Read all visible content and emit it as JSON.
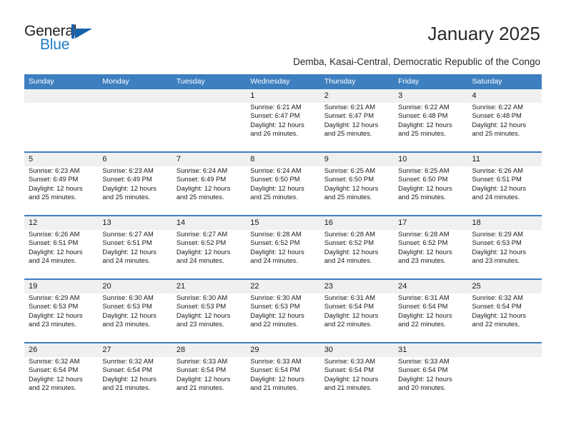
{
  "brand": {
    "name_part1": "General",
    "name_part2": "Blue",
    "accent_color": "#1d7cc4",
    "logo_mark_color": "#1763ab"
  },
  "header": {
    "title": "January 2025",
    "subtitle": "Demba, Kasai-Central, Democratic Republic of the Congo"
  },
  "theme": {
    "header_blue": "#3d7fbf",
    "daynum_band": "#f0f0f0",
    "week_separator": "#3d7fbf"
  },
  "weekdays": [
    "Sunday",
    "Monday",
    "Tuesday",
    "Wednesday",
    "Thursday",
    "Friday",
    "Saturday"
  ],
  "weeks": [
    [
      {
        "day": "",
        "l1": "",
        "l2": "",
        "l3": "",
        "l4": ""
      },
      {
        "day": "",
        "l1": "",
        "l2": "",
        "l3": "",
        "l4": ""
      },
      {
        "day": "",
        "l1": "",
        "l2": "",
        "l3": "",
        "l4": ""
      },
      {
        "day": "1",
        "l1": "Sunrise: 6:21 AM",
        "l2": "Sunset: 6:47 PM",
        "l3": "Daylight: 12 hours",
        "l4": "and 26 minutes."
      },
      {
        "day": "2",
        "l1": "Sunrise: 6:21 AM",
        "l2": "Sunset: 6:47 PM",
        "l3": "Daylight: 12 hours",
        "l4": "and 25 minutes."
      },
      {
        "day": "3",
        "l1": "Sunrise: 6:22 AM",
        "l2": "Sunset: 6:48 PM",
        "l3": "Daylight: 12 hours",
        "l4": "and 25 minutes."
      },
      {
        "day": "4",
        "l1": "Sunrise: 6:22 AM",
        "l2": "Sunset: 6:48 PM",
        "l3": "Daylight: 12 hours",
        "l4": "and 25 minutes."
      }
    ],
    [
      {
        "day": "5",
        "l1": "Sunrise: 6:23 AM",
        "l2": "Sunset: 6:49 PM",
        "l3": "Daylight: 12 hours",
        "l4": "and 25 minutes."
      },
      {
        "day": "6",
        "l1": "Sunrise: 6:23 AM",
        "l2": "Sunset: 6:49 PM",
        "l3": "Daylight: 12 hours",
        "l4": "and 25 minutes."
      },
      {
        "day": "7",
        "l1": "Sunrise: 6:24 AM",
        "l2": "Sunset: 6:49 PM",
        "l3": "Daylight: 12 hours",
        "l4": "and 25 minutes."
      },
      {
        "day": "8",
        "l1": "Sunrise: 6:24 AM",
        "l2": "Sunset: 6:50 PM",
        "l3": "Daylight: 12 hours",
        "l4": "and 25 minutes."
      },
      {
        "day": "9",
        "l1": "Sunrise: 6:25 AM",
        "l2": "Sunset: 6:50 PM",
        "l3": "Daylight: 12 hours",
        "l4": "and 25 minutes."
      },
      {
        "day": "10",
        "l1": "Sunrise: 6:25 AM",
        "l2": "Sunset: 6:50 PM",
        "l3": "Daylight: 12 hours",
        "l4": "and 25 minutes."
      },
      {
        "day": "11",
        "l1": "Sunrise: 6:26 AM",
        "l2": "Sunset: 6:51 PM",
        "l3": "Daylight: 12 hours",
        "l4": "and 24 minutes."
      }
    ],
    [
      {
        "day": "12",
        "l1": "Sunrise: 6:26 AM",
        "l2": "Sunset: 6:51 PM",
        "l3": "Daylight: 12 hours",
        "l4": "and 24 minutes."
      },
      {
        "day": "13",
        "l1": "Sunrise: 6:27 AM",
        "l2": "Sunset: 6:51 PM",
        "l3": "Daylight: 12 hours",
        "l4": "and 24 minutes."
      },
      {
        "day": "14",
        "l1": "Sunrise: 6:27 AM",
        "l2": "Sunset: 6:52 PM",
        "l3": "Daylight: 12 hours",
        "l4": "and 24 minutes."
      },
      {
        "day": "15",
        "l1": "Sunrise: 6:28 AM",
        "l2": "Sunset: 6:52 PM",
        "l3": "Daylight: 12 hours",
        "l4": "and 24 minutes."
      },
      {
        "day": "16",
        "l1": "Sunrise: 6:28 AM",
        "l2": "Sunset: 6:52 PM",
        "l3": "Daylight: 12 hours",
        "l4": "and 24 minutes."
      },
      {
        "day": "17",
        "l1": "Sunrise: 6:28 AM",
        "l2": "Sunset: 6:52 PM",
        "l3": "Daylight: 12 hours",
        "l4": "and 23 minutes."
      },
      {
        "day": "18",
        "l1": "Sunrise: 6:29 AM",
        "l2": "Sunset: 6:53 PM",
        "l3": "Daylight: 12 hours",
        "l4": "and 23 minutes."
      }
    ],
    [
      {
        "day": "19",
        "l1": "Sunrise: 6:29 AM",
        "l2": "Sunset: 6:53 PM",
        "l3": "Daylight: 12 hours",
        "l4": "and 23 minutes."
      },
      {
        "day": "20",
        "l1": "Sunrise: 6:30 AM",
        "l2": "Sunset: 6:53 PM",
        "l3": "Daylight: 12 hours",
        "l4": "and 23 minutes."
      },
      {
        "day": "21",
        "l1": "Sunrise: 6:30 AM",
        "l2": "Sunset: 6:53 PM",
        "l3": "Daylight: 12 hours",
        "l4": "and 23 minutes."
      },
      {
        "day": "22",
        "l1": "Sunrise: 6:30 AM",
        "l2": "Sunset: 6:53 PM",
        "l3": "Daylight: 12 hours",
        "l4": "and 22 minutes."
      },
      {
        "day": "23",
        "l1": "Sunrise: 6:31 AM",
        "l2": "Sunset: 6:54 PM",
        "l3": "Daylight: 12 hours",
        "l4": "and 22 minutes."
      },
      {
        "day": "24",
        "l1": "Sunrise: 6:31 AM",
        "l2": "Sunset: 6:54 PM",
        "l3": "Daylight: 12 hours",
        "l4": "and 22 minutes."
      },
      {
        "day": "25",
        "l1": "Sunrise: 6:32 AM",
        "l2": "Sunset: 6:54 PM",
        "l3": "Daylight: 12 hours",
        "l4": "and 22 minutes."
      }
    ],
    [
      {
        "day": "26",
        "l1": "Sunrise: 6:32 AM",
        "l2": "Sunset: 6:54 PM",
        "l3": "Daylight: 12 hours",
        "l4": "and 22 minutes."
      },
      {
        "day": "27",
        "l1": "Sunrise: 6:32 AM",
        "l2": "Sunset: 6:54 PM",
        "l3": "Daylight: 12 hours",
        "l4": "and 21 minutes."
      },
      {
        "day": "28",
        "l1": "Sunrise: 6:33 AM",
        "l2": "Sunset: 6:54 PM",
        "l3": "Daylight: 12 hours",
        "l4": "and 21 minutes."
      },
      {
        "day": "29",
        "l1": "Sunrise: 6:33 AM",
        "l2": "Sunset: 6:54 PM",
        "l3": "Daylight: 12 hours",
        "l4": "and 21 minutes."
      },
      {
        "day": "30",
        "l1": "Sunrise: 6:33 AM",
        "l2": "Sunset: 6:54 PM",
        "l3": "Daylight: 12 hours",
        "l4": "and 21 minutes."
      },
      {
        "day": "31",
        "l1": "Sunrise: 6:33 AM",
        "l2": "Sunset: 6:54 PM",
        "l3": "Daylight: 12 hours",
        "l4": "and 20 minutes."
      },
      {
        "day": "",
        "l1": "",
        "l2": "",
        "l3": "",
        "l4": ""
      }
    ]
  ]
}
